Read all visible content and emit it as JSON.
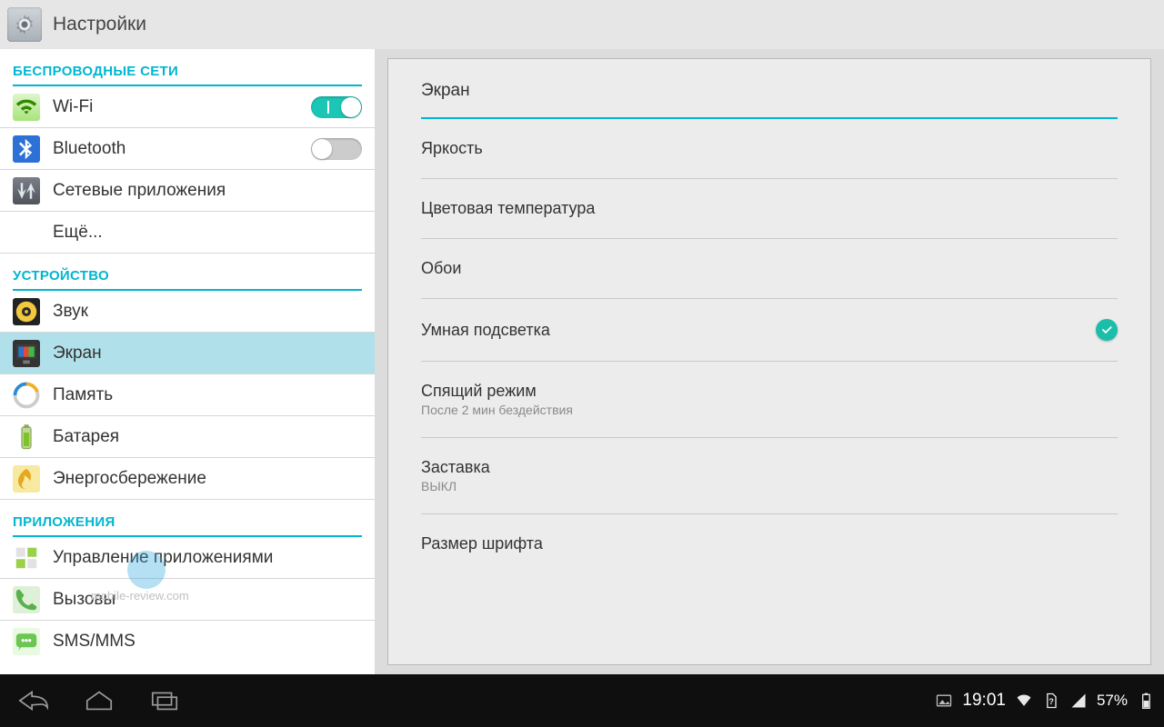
{
  "app": {
    "title": "Настройки"
  },
  "sidebar": {
    "sections": {
      "wireless": {
        "header": "БЕСПРОВОДНЫЕ СЕТИ",
        "items": [
          {
            "label": "Wi-Fi",
            "toggle": true
          },
          {
            "label": "Bluetooth",
            "toggle": false
          },
          {
            "label": "Сетевые приложения"
          },
          {
            "label": "Ещё..."
          }
        ]
      },
      "device": {
        "header": "УСТРОЙСТВО",
        "items": [
          {
            "label": "Звук"
          },
          {
            "label": "Экран",
            "selected": true
          },
          {
            "label": "Память"
          },
          {
            "label": "Батарея"
          },
          {
            "label": "Энергосбережение"
          }
        ]
      },
      "apps": {
        "header": "ПРИЛОЖЕНИЯ",
        "items": [
          {
            "label": "Управление приложениями"
          },
          {
            "label": "Вызовы"
          },
          {
            "label": "SMS/MMS"
          }
        ]
      }
    }
  },
  "detail": {
    "title": "Экран",
    "options": [
      {
        "primary": "Яркость"
      },
      {
        "primary": "Цветовая температура"
      },
      {
        "primary": "Обои"
      },
      {
        "primary": "Умная подсветка",
        "checked": true
      },
      {
        "primary": "Спящий режим",
        "secondary": "После 2 мин бездействия"
      },
      {
        "primary": "Заставка",
        "secondary": "ВЫКЛ"
      },
      {
        "primary": "Размер шрифта"
      }
    ]
  },
  "navbar": {
    "time": "19:01",
    "battery_percent": "57%"
  },
  "watermark": "mobile-review.com"
}
